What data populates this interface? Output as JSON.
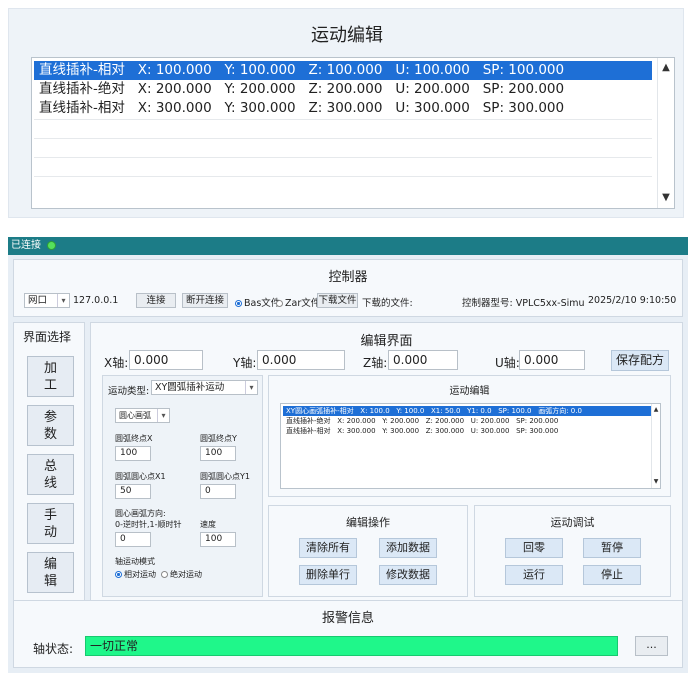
{
  "top": {
    "title": "运动编辑",
    "rows": [
      "直线插补-相对   X: 100.000   Y: 100.000   Z: 100.000   U: 100.000   SP: 100.000",
      "直线插补-绝对   X: 200.000   Y: 200.000   Z: 200.000   U: 200.000   SP: 200.000",
      "直线插补-相对   X: 300.000   Y: 300.000   Z: 300.000   U: 300.000   SP: 300.000"
    ],
    "selected_index": 0
  },
  "titlebar": {
    "status": "已连接"
  },
  "controller": {
    "title": "控制器",
    "port_label": "网口",
    "ip": "127.0.0.1",
    "connect": "连接",
    "disconnect": "断开连接",
    "bas_file": "Bas文件",
    "zar_file": "Zar文件",
    "download_file": "下载文件",
    "downloaded_file_label": "下载的文件:",
    "model": "控制器型号: VPLC5xx-Simu",
    "datetime": "2025/2/10 9:10:50"
  },
  "sidebar": {
    "title": "界面选择",
    "items": [
      "加\n工",
      "参\n数",
      "总\n线",
      "手\n动",
      "编\n辑"
    ]
  },
  "edit": {
    "title": "编辑界面",
    "x_label": "X轴:",
    "x_value": "0.000",
    "y_label": "Y轴:",
    "y_value": "0.000",
    "z_label": "Z轴:",
    "z_value": "0.000",
    "u_label": "U轴:",
    "u_value": "0.000",
    "save_recipe": "保存配方",
    "motion_type_label": "运动类型:",
    "motion_type_value": "XY圆弧插补运动",
    "arc_mode": "圆心画弧",
    "arc_end_x_label": "圆弧终点X",
    "arc_end_x": "100",
    "arc_end_y_label": "圆弧终点Y",
    "arc_end_y": "100",
    "arc_center_x1_label": "圆弧圆心点X1",
    "arc_center_x1": "50",
    "arc_center_y1_label": "圆弧圆心点Y1",
    "arc_center_y1": "0",
    "arc_dir_label": "圆心画弧方向:",
    "arc_dir_hint": "0-逆时针,1-顺时针",
    "arc_dir_value": "0",
    "speed_label": "速度",
    "speed_value": "100",
    "axis_mode_label": "轴运动模式",
    "relative": "相对运动",
    "absolute": "绝对运动",
    "motion_edit_title": "运动编辑",
    "mini_rows": [
      "XY圆心画弧插补-相对   X: 100.0   Y: 100.0   X1: 50.0   Y1: 0.0   SP: 100.0   画弧方向: 0.0",
      "直线插补-绝对   X: 200.000   Y: 200.000   Z: 200.000   U: 200.000   SP: 200.000",
      "直线插补-相对   X: 300.000   Y: 300.000   Z: 300.000   U: 300.000   SP: 300.000"
    ],
    "edit_ops_title": "编辑操作",
    "clear_all": "清除所有",
    "add_data": "添加数据",
    "delete_row": "删除单行",
    "modify_data": "修改数据",
    "debug_title": "运动调试",
    "home": "回零",
    "pause": "暂停",
    "run": "运行",
    "stop": "停止"
  },
  "alarm": {
    "title": "报警信息",
    "axis_status_label": "轴状态:",
    "axis_status_value": "一切正常",
    "more_button": "..."
  },
  "colors": {
    "selection": "#1e6fd6",
    "titlebar": "#1c7c87",
    "status_ok": "#1ff78a",
    "connected_dot": "#55e05c"
  }
}
